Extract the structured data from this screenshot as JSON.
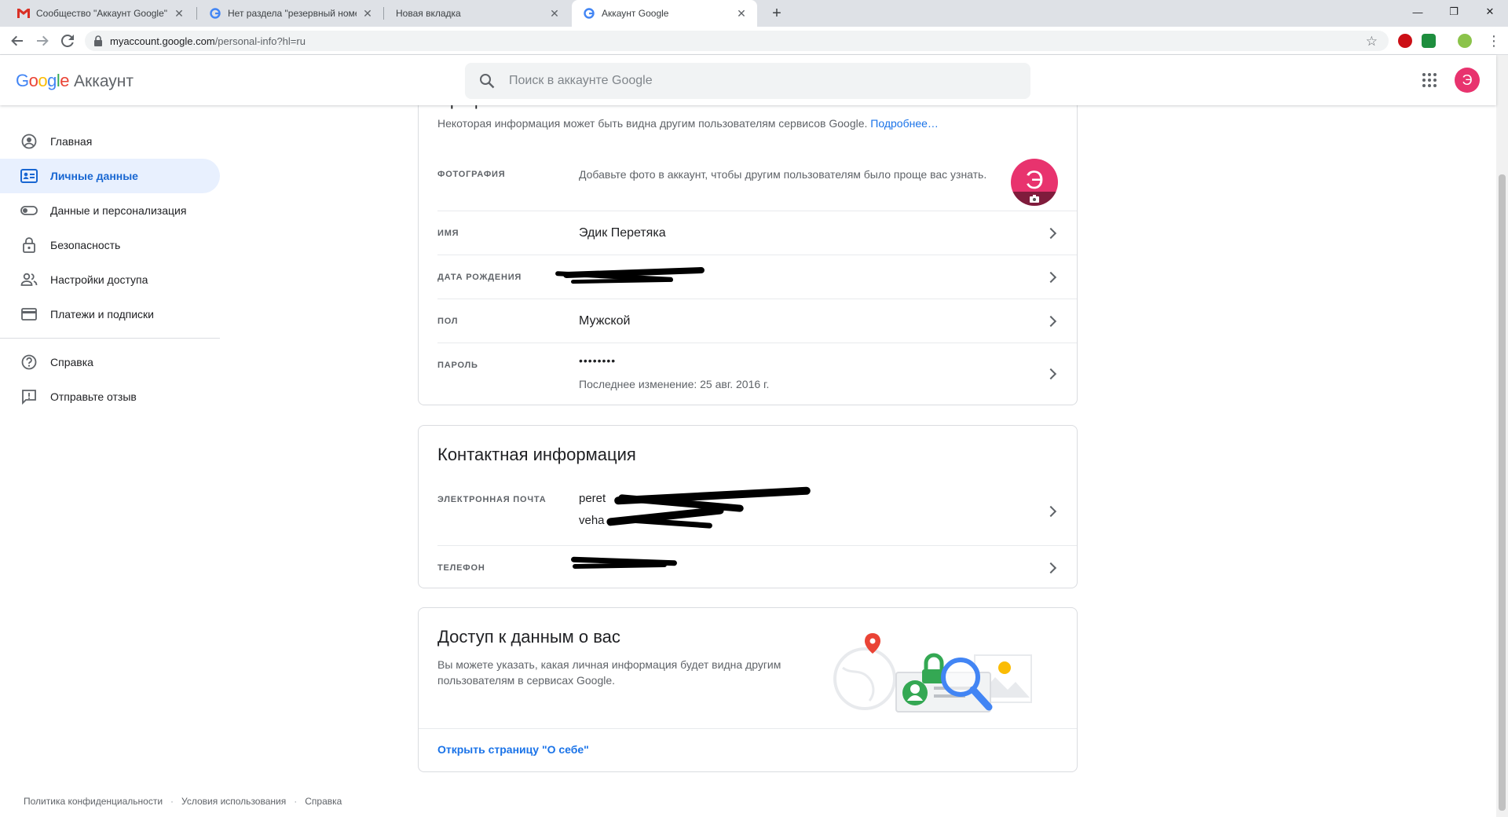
{
  "browser": {
    "tabs": [
      {
        "title": "Сообщество \"Аккаунт Google\"",
        "favicon": "gmail-icon"
      },
      {
        "title": "Нет раздела \"резервный номер\"",
        "favicon": "google-g-icon"
      },
      {
        "title": "Новая вкладка",
        "favicon": ""
      },
      {
        "title": "Аккаунт Google",
        "favicon": "google-g-icon",
        "active": true
      }
    ],
    "url_host": "myaccount.google.com",
    "url_path": "/personal-info?hl=ru"
  },
  "header": {
    "logo_google": "Google",
    "logo_product": "Аккаунт",
    "search_placeholder": "Поиск в аккаунте Google",
    "avatar_letter": "Э"
  },
  "sidebar": {
    "items": [
      {
        "label": "Главная",
        "icon": "account-circle-icon"
      },
      {
        "label": "Личные данные",
        "icon": "id-card-icon",
        "active": true
      },
      {
        "label": "Данные и персонализация",
        "icon": "toggle-icon"
      },
      {
        "label": "Безопасность",
        "icon": "lock-icon"
      },
      {
        "label": "Настройки доступа",
        "icon": "people-icon"
      },
      {
        "label": "Платежи и подписки",
        "icon": "credit-card-icon"
      }
    ],
    "secondary": [
      {
        "label": "Справка",
        "icon": "help-icon"
      },
      {
        "label": "Отправьте отзыв",
        "icon": "feedback-icon"
      }
    ]
  },
  "profile": {
    "heading_partial": "Профиль",
    "note": "Некоторая информация может быть видна другим пользователям сервисов Google.",
    "more_link": "Подробнее…",
    "photo_label": "ФОТОГРАФИЯ",
    "photo_text": "Добавьте фото в аккаунт, чтобы другим пользователям было проще вас узнать.",
    "photo_letter": "Э",
    "name_label": "ИМЯ",
    "name_value": "Эдик Перетяка",
    "birth_label": "ДАТА РОЖДЕНИЯ",
    "gender_label": "ПОЛ",
    "gender_value": "Мужской",
    "password_label": "ПАРОЛЬ",
    "password_value": "••••••••",
    "password_changed": "Последнее изменение: 25 авг. 2016 г."
  },
  "contacts": {
    "heading": "Контактная информация",
    "email_label": "ЭЛЕКТРОННАЯ ПОЧТА",
    "email_1_visible": "peret",
    "email_2_visible": "veha",
    "phone_label": "ТЕЛЕФОН"
  },
  "access": {
    "heading": "Доступ к данным о вас",
    "text": "Вы можете указать, какая личная информация будет видна другим пользователям в сервисах Google.",
    "link": "Открыть страницу \"О себе\""
  },
  "footer": {
    "privacy": "Политика конфиденциальности",
    "terms": "Условия использования",
    "help": "Справка"
  },
  "colors": {
    "accent": "#1a73e8",
    "active_nav_bg": "#e8f0fe",
    "avatar": "#e8336e"
  }
}
